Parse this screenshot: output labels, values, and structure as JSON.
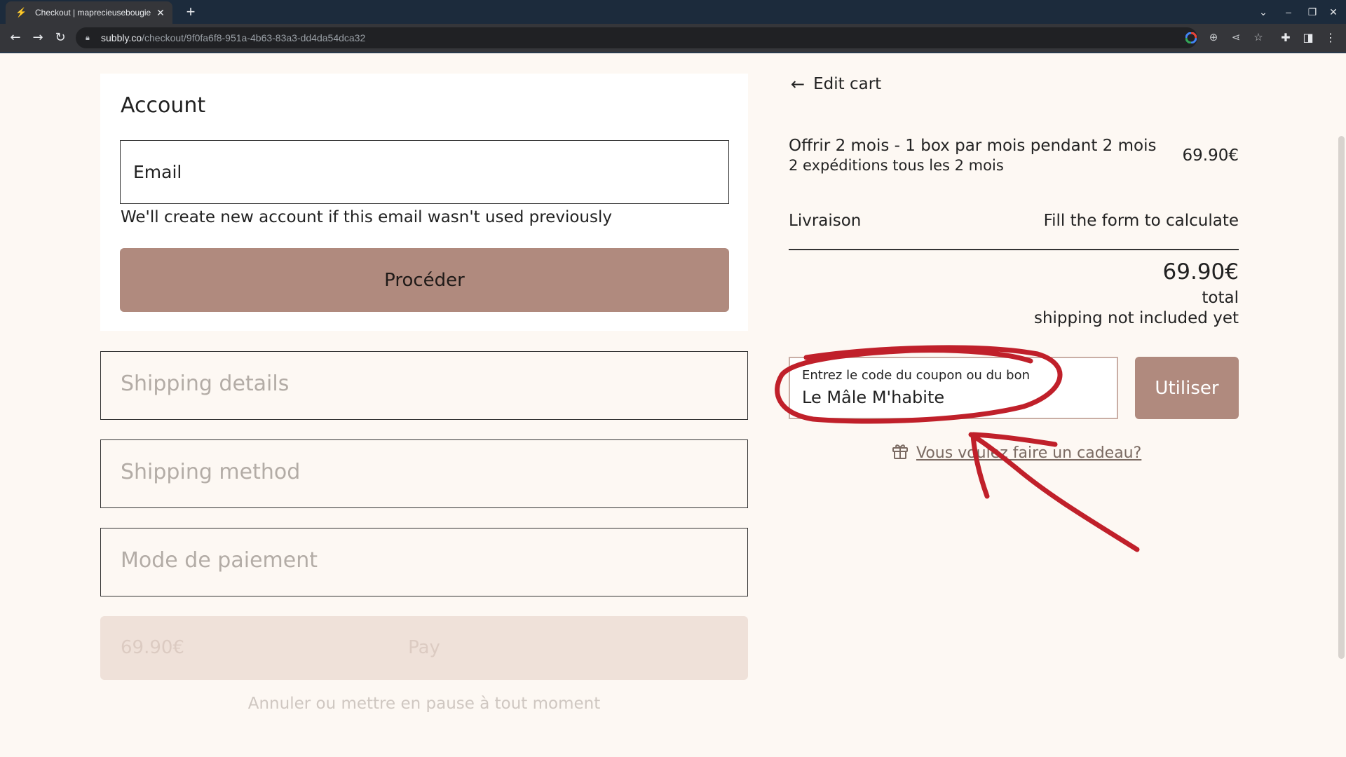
{
  "browser": {
    "tab_title": "Checkout | maprecieusebougie",
    "url_host": "subbly.co",
    "url_path": "/checkout/9f0fa6f8-951a-4b63-83a3-dd4da54dca32"
  },
  "account": {
    "title": "Account",
    "email_placeholder": "Email",
    "email_hint": "We'll create new account if this email wasn't used previously",
    "proceed_label": "Procéder"
  },
  "sections": {
    "shipping_details": "Shipping details",
    "shipping_method": "Shipping method",
    "payment_method": "Mode de paiement"
  },
  "pay": {
    "amount": "69.90€",
    "label": "Pay",
    "cancel_note": "Annuler ou mettre en pause à tout moment"
  },
  "summary": {
    "edit_cart": "Edit cart",
    "item_name": "Offrir 2 mois - 1 box par mois pendant 2 mois",
    "item_sub": "2 expéditions tous les 2 mois",
    "item_price": "69.90€",
    "shipping_label": "Livraison",
    "shipping_value": "Fill the form to calculate",
    "total_amount": "69.90€",
    "total_label": "total",
    "total_note": "shipping not included yet"
  },
  "coupon": {
    "label": "Entrez le code du coupon ou du bon",
    "value": "Le Mâle M'habite",
    "button": "Utiliser"
  },
  "gift": {
    "link": "Vous voulez faire un cadeau?"
  },
  "colors": {
    "accent": "#b08a7e",
    "annotation": "#c0202a",
    "background": "#fdf8f3"
  }
}
